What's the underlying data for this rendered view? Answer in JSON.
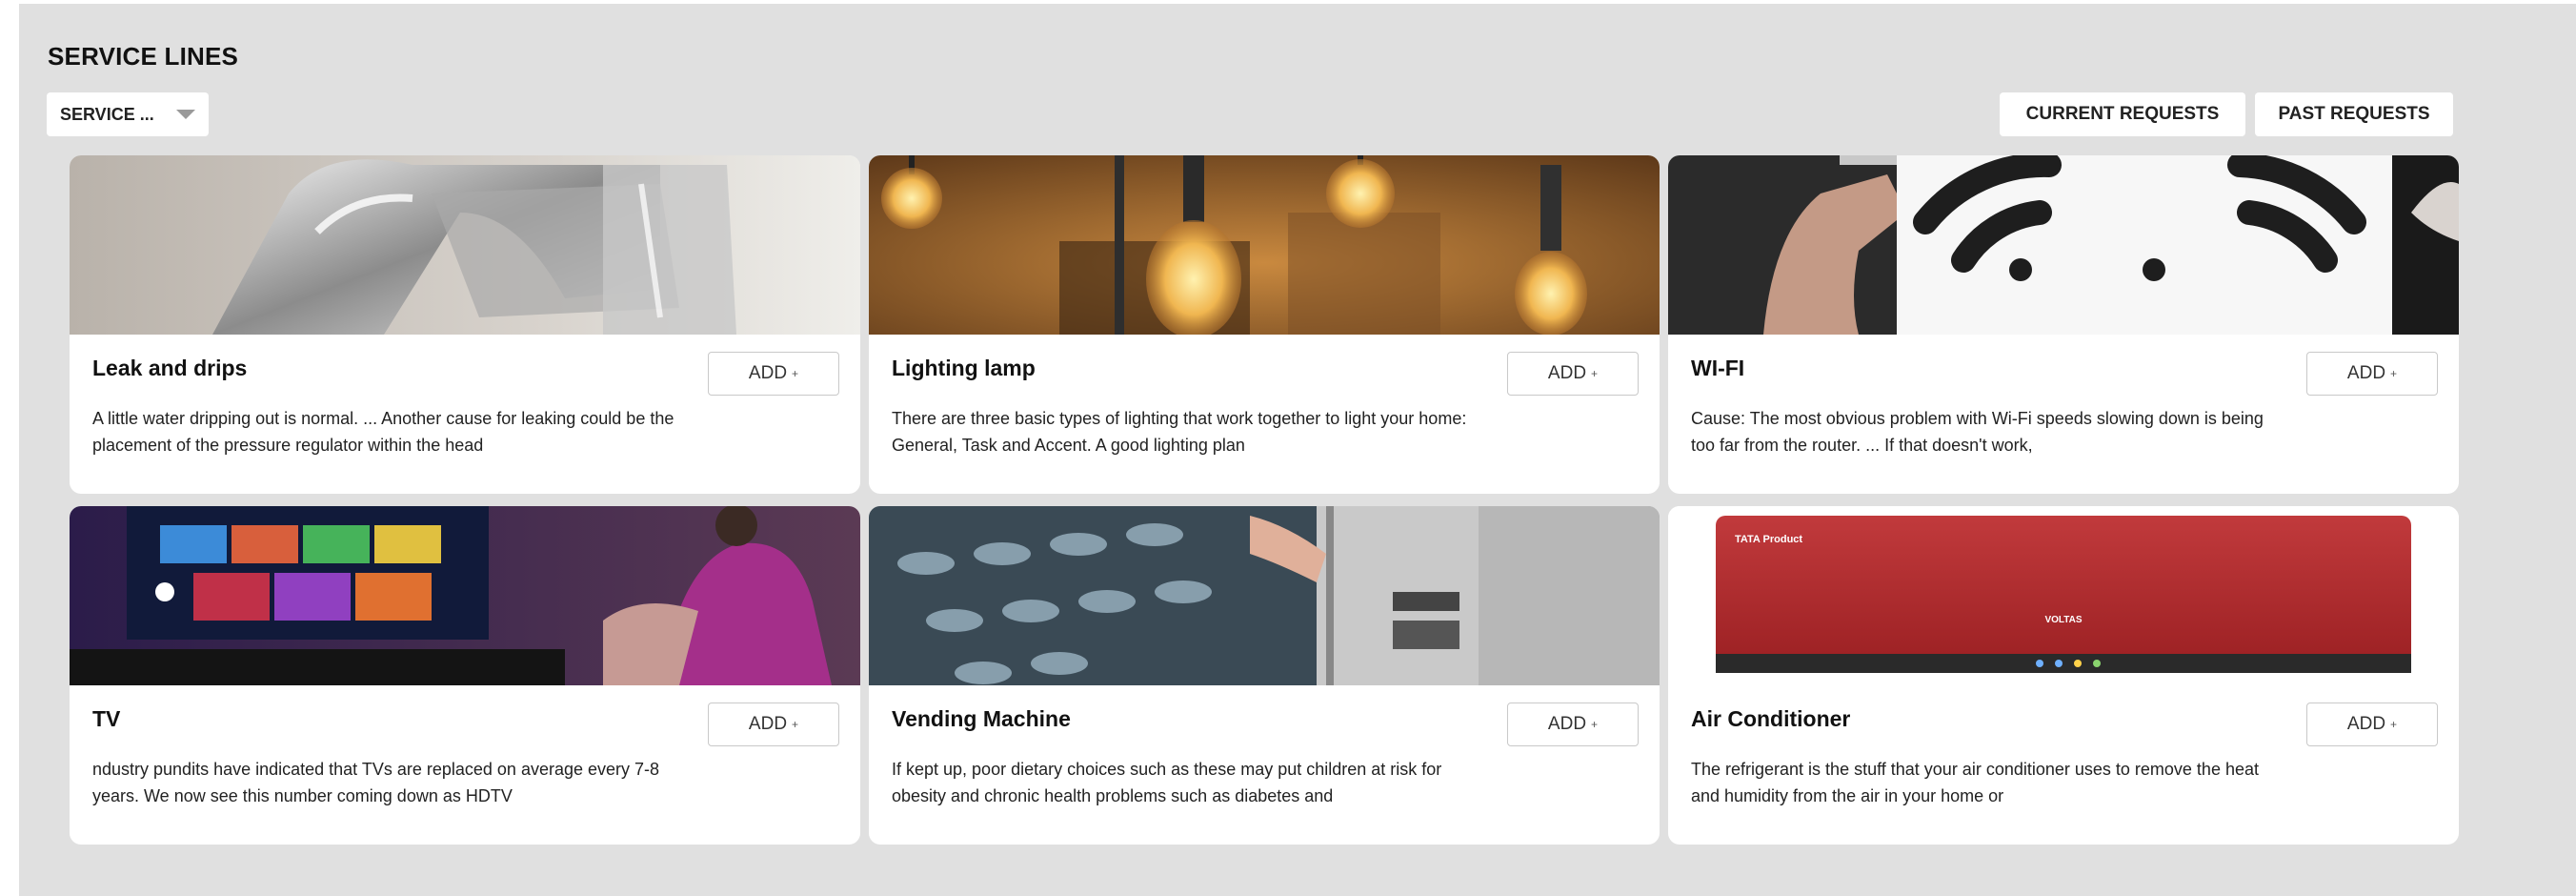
{
  "header": {
    "title": "SERVICE LINES",
    "filter_value": "SERVICE ...",
    "current_requests_label": "CURRENT REQUESTS",
    "past_requests_label": "PAST REQUESTS"
  },
  "cards": [
    {
      "name": "Leak and drips",
      "add_label": "ADD",
      "description": "A little water dripping out is normal. ... Another cause for leaking could be the placement of the pressure regulator within the head",
      "image_icon": "faucet-image"
    },
    {
      "name": "Lighting lamp",
      "add_label": "ADD",
      "description": "There are three basic types of lighting that work together to light your home: General, Task and Accent. A good lighting plan",
      "image_icon": "light-bulbs-image"
    },
    {
      "name": "WI-FI",
      "add_label": "ADD",
      "description": "Cause: The most obvious problem with Wi-Fi speeds slowing down is being too far from the router. ... If that doesn't work,",
      "image_icon": "wifi-image"
    },
    {
      "name": "TV",
      "add_label": "ADD",
      "description": "ndustry pundits have indicated that TVs are replaced on average every 7-8 years. We now see this number coming down as HDTV",
      "image_icon": "tv-image"
    },
    {
      "name": "Vending Machine",
      "add_label": "ADD",
      "description": "If kept up, poor dietary choices such as these may put children at risk for obesity and chronic health problems such as diabetes and",
      "image_icon": "vending-machine-image"
    },
    {
      "name": "Air Conditioner",
      "add_label": "ADD",
      "description": "The refrigerant is the stuff that your air conditioner uses to remove the heat and humidity from the air in your home or",
      "image_icon": "air-conditioner-image",
      "image_text": [
        "TATA Product",
        "VOLTAS"
      ]
    }
  ]
}
